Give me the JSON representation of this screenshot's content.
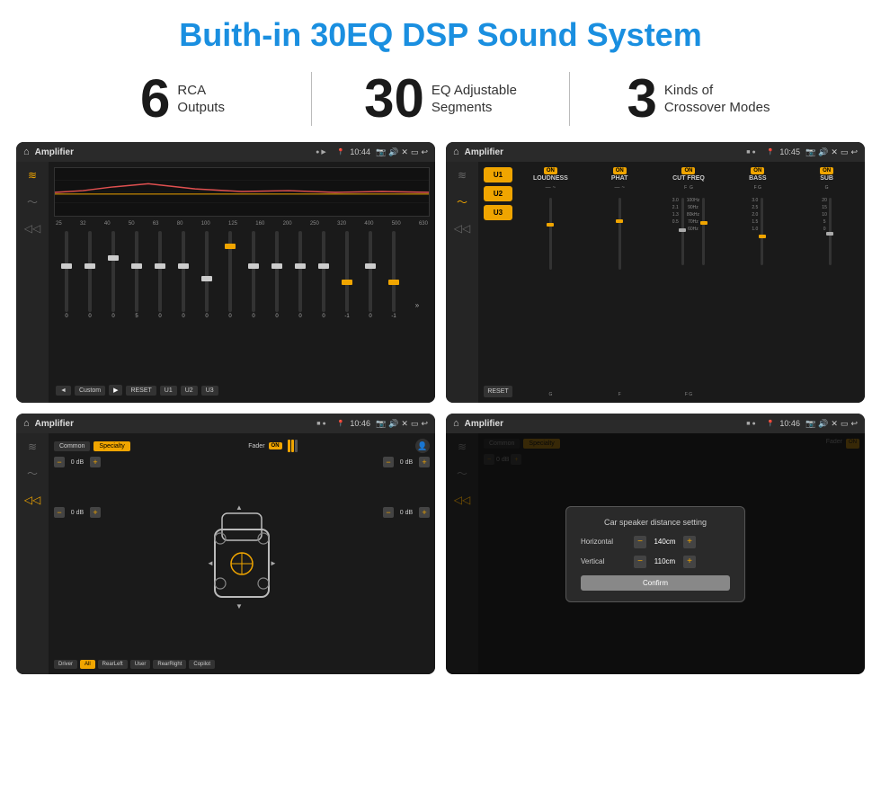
{
  "page": {
    "title": "Buith-in 30EQ DSP Sound System",
    "stats": [
      {
        "number": "6",
        "label_line1": "RCA",
        "label_line2": "Outputs"
      },
      {
        "number": "30",
        "label_line1": "EQ Adjustable",
        "label_line2": "Segments"
      },
      {
        "number": "3",
        "label_line1": "Kinds of",
        "label_line2": "Crossover Modes"
      }
    ]
  },
  "screens": {
    "screen1": {
      "topbar": {
        "title": "Amplifier",
        "time": "10:44"
      },
      "eq_freqs": [
        "25",
        "32",
        "40",
        "50",
        "63",
        "80",
        "100",
        "125",
        "160",
        "200",
        "250",
        "320",
        "400",
        "500",
        "630"
      ],
      "bottom_buttons": [
        "◄",
        "Custom",
        "▶",
        "RESET",
        "U1",
        "U2",
        "U3"
      ]
    },
    "screen2": {
      "topbar": {
        "title": "Amplifier",
        "time": "10:45"
      },
      "channels": [
        "LOUDNESS",
        "PHAT",
        "CUT FREQ",
        "BASS",
        "SUB"
      ],
      "u_buttons": [
        "U1",
        "U2",
        "U3"
      ]
    },
    "screen3": {
      "topbar": {
        "title": "Amplifier",
        "time": "10:46"
      },
      "tabs": [
        "Common",
        "Specialty"
      ],
      "fader_label": "Fader",
      "db_values": [
        "0 dB",
        "0 dB",
        "0 dB",
        "0 dB"
      ],
      "bottom_buttons": [
        "Driver",
        "RearLeft",
        "All",
        "User",
        "RearRight",
        "Copilot"
      ]
    },
    "screen4": {
      "topbar": {
        "title": "Amplifier",
        "time": "10:46"
      },
      "tabs": [
        "Common",
        "Specialty"
      ],
      "dialog": {
        "title": "Car speaker distance setting",
        "horizontal_label": "Horizontal",
        "horizontal_value": "140cm",
        "vertical_label": "Vertical",
        "vertical_value": "110cm",
        "confirm_label": "Confirm"
      }
    }
  }
}
